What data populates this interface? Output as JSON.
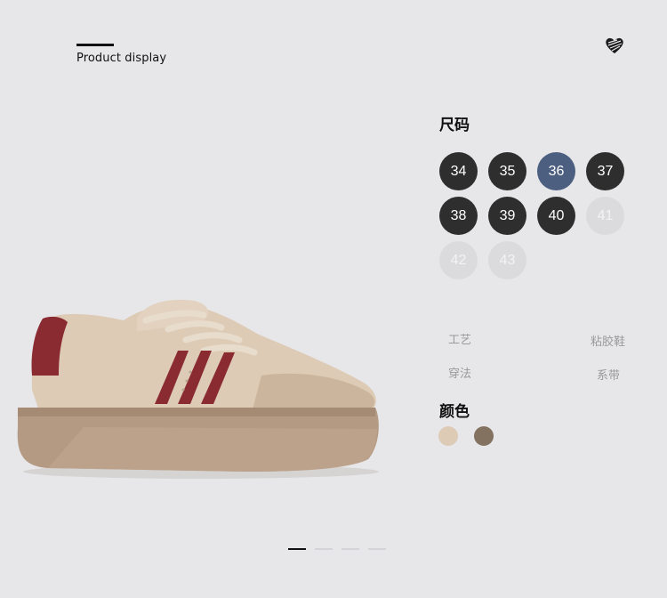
{
  "header": {
    "title": "Product display",
    "favorite_icon": "heart-icon"
  },
  "size": {
    "title": "尺码",
    "options": [
      {
        "label": "34",
        "state": "available"
      },
      {
        "label": "35",
        "state": "available"
      },
      {
        "label": "36",
        "state": "selected"
      },
      {
        "label": "37",
        "state": "available"
      },
      {
        "label": "38",
        "state": "available"
      },
      {
        "label": "39",
        "state": "available"
      },
      {
        "label": "40",
        "state": "available"
      },
      {
        "label": "41",
        "state": "unavailable"
      },
      {
        "label": "42",
        "state": "unavailable"
      },
      {
        "label": "43",
        "state": "unavailable"
      }
    ]
  },
  "attributes": {
    "craft_label": "工艺",
    "craft_value": "粘胶鞋",
    "lacing_label": "穿法",
    "lacing_value": "系带"
  },
  "color": {
    "title": "颜色",
    "swatches": [
      {
        "name": "beige",
        "hex": "#ddcbb6"
      },
      {
        "name": "brown",
        "hex": "#847261"
      }
    ]
  },
  "pager": {
    "count": 4,
    "active_index": 0
  },
  "colors": {
    "accent_selected": "#4d5f80",
    "size_default": "#2e2e2e",
    "size_disabled": "#dbdbde",
    "background": "#e7e7ea"
  }
}
